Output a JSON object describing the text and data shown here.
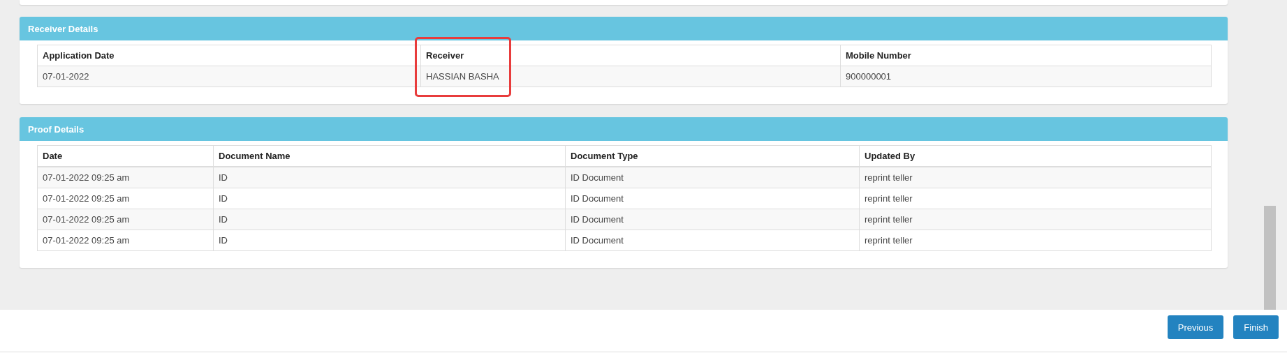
{
  "receiver_details": {
    "title": "Receiver Details",
    "columns": [
      {
        "label": "Application Date",
        "highlighted": false
      },
      {
        "label": "Receiver",
        "highlighted": true
      },
      {
        "label": "Mobile Number",
        "highlighted": false
      }
    ],
    "rows": [
      [
        "07-01-2022",
        "HASSIAN BASHA",
        "900000001"
      ]
    ]
  },
  "proof_details": {
    "title": "Proof Details",
    "columns": [
      {
        "label": "Date"
      },
      {
        "label": "Document Name"
      },
      {
        "label": "Document Type"
      },
      {
        "label": "Updated By"
      }
    ],
    "rows": [
      [
        "07-01-2022 09:25 am",
        "ID",
        "ID Document",
        "reprint teller"
      ],
      [
        "07-01-2022 09:25 am",
        "ID",
        "ID Document",
        "reprint teller"
      ],
      [
        "07-01-2022 09:25 am",
        "ID",
        "ID Document",
        "reprint teller"
      ],
      [
        "07-01-2022 09:25 am",
        "ID",
        "ID Document",
        "reprint teller"
      ]
    ]
  },
  "buttons": [
    "Previous",
    "Finish"
  ]
}
